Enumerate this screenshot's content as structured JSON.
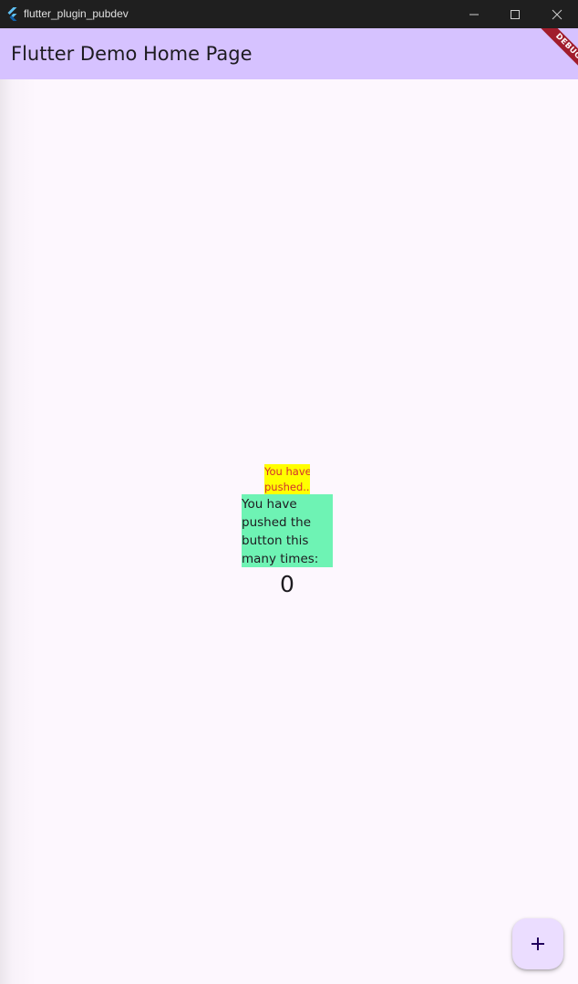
{
  "window": {
    "title": "flutter_plugin_pubdev",
    "controls": {
      "minimize_icon": "minimize-icon",
      "maximize_icon": "maximize-icon",
      "close_icon": "close-icon"
    }
  },
  "appbar": {
    "title": "Flutter Demo Home Page",
    "background": "#d6c2ff"
  },
  "debug_banner": {
    "label": "DEBUG",
    "color": "#a11d2c"
  },
  "body": {
    "truncated_label_line1": "You have",
    "truncated_label_line2": "pushed...",
    "truncated_label_bg": "#ffff00",
    "truncated_label_color": "#d32f2f",
    "full_label": "You have pushed the button this many times:",
    "full_label_bg": "#6ef3b4",
    "counter": "0"
  },
  "fab": {
    "icon": "plus-icon",
    "background": "#ebddff"
  }
}
